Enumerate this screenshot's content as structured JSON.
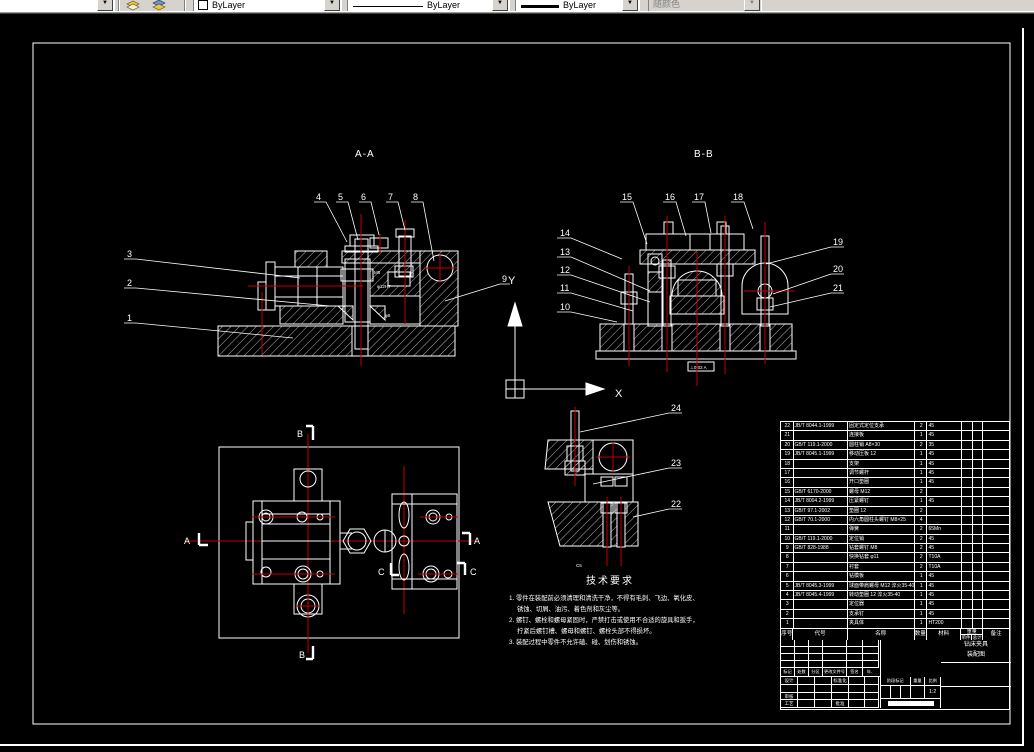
{
  "toolbar": {
    "color_combo": {
      "value": "ByLayer"
    },
    "linetype_combo": {
      "value": "ByLayer"
    },
    "lineweight_combo": {
      "value": "ByLayer"
    },
    "plotstyle_combo": {
      "value": "随颜色"
    },
    "dropdown_arrow": "▼"
  },
  "drawing": {
    "section_labels": {
      "aa": "A-A",
      "bb": "B-B"
    },
    "plan_marks": {
      "top": "B",
      "bottom": "B",
      "left": "A",
      "right": "A",
      "c_inner": "C",
      "c_outer": "C"
    },
    "ucs": {
      "x": "X",
      "y": "Y"
    },
    "balloons": [
      "1",
      "2",
      "3",
      "4",
      "5",
      "6",
      "7",
      "8",
      "9",
      "10",
      "11",
      "12",
      "13",
      "14",
      "15",
      "16",
      "17",
      "18",
      "19",
      "20",
      "21",
      "22",
      "23",
      "24"
    ],
    "dims": {
      "d1": "M8",
      "d2": "φ12H7",
      "d3": "φ8",
      "d4": "C5",
      "tol": "⊥0.02 A"
    }
  },
  "tech_requirements": {
    "title": "技术要求",
    "lines": [
      "1. 零件在装配前必须清理和清洗干净，不得有毛刺、飞边、氧化皮、",
      "锈蚀、切屑、油污、着色剂和灰尘等。",
      "2. 螺钉、螺栓和螺母紧固时，严禁打击或使用不合适的旋具和扳手，",
      "拧紧后螺钉槽、螺母和螺钉、螺栓头部不得损坏。",
      "3. 装配过程中零件不允许磕、碰、划伤和锈蚀。"
    ]
  },
  "bom": {
    "headers": {
      "no": "序号",
      "code": "代号",
      "name": "名称",
      "qty": "数量",
      "mat": "材料",
      "weight": "重量",
      "w1": "单件",
      "w2": "总计",
      "note": "备注"
    },
    "rows": [
      {
        "no": "22",
        "code": "JB/T 8044.1-1999",
        "name": "固定式定位支承",
        "qty": "2",
        "mat": "45",
        "w1": "",
        "w2": "",
        "note": ""
      },
      {
        "no": "21",
        "code": "",
        "name": "连接板",
        "qty": "1",
        "mat": "45",
        "w1": "",
        "w2": "",
        "note": ""
      },
      {
        "no": "20",
        "code": "GB/T 119.1-2000",
        "name": "圆柱销 A8×30",
        "qty": "2",
        "mat": "35",
        "w1": "",
        "w2": "",
        "note": ""
      },
      {
        "no": "19",
        "code": "JB/T 8045.1-1999",
        "name": "移动压板 12",
        "qty": "1",
        "mat": "45",
        "w1": "",
        "w2": "",
        "note": ""
      },
      {
        "no": "18",
        "code": "",
        "name": "支架",
        "qty": "1",
        "mat": "45",
        "w1": "",
        "w2": "",
        "note": ""
      },
      {
        "no": "17",
        "code": "",
        "name": "调节螺杆",
        "qty": "1",
        "mat": "45",
        "w1": "",
        "w2": "",
        "note": ""
      },
      {
        "no": "16",
        "code": "",
        "name": "开口垫圈",
        "qty": "1",
        "mat": "45",
        "w1": "",
        "w2": "",
        "note": ""
      },
      {
        "no": "15",
        "code": "GB/T 6170-2000",
        "name": "螺母 M12",
        "qty": "2",
        "mat": "",
        "w1": "",
        "w2": "",
        "note": ""
      },
      {
        "no": "14",
        "code": "JB/T 8004.2-1999",
        "name": "压紧螺钉",
        "qty": "1",
        "mat": "45",
        "w1": "",
        "w2": "",
        "note": ""
      },
      {
        "no": "13",
        "code": "GB/T 97.1-2002",
        "name": "垫圈 12",
        "qty": "2",
        "mat": "",
        "w1": "",
        "w2": "",
        "note": ""
      },
      {
        "no": "12",
        "code": "GB/T 70.1-2000",
        "name": "内六角圆柱头螺钉 M8×25",
        "qty": "4",
        "mat": "",
        "w1": "",
        "w2": "",
        "note": ""
      },
      {
        "no": "11",
        "code": "",
        "name": "弹簧",
        "qty": "2",
        "mat": "65Mn",
        "w1": "",
        "w2": "",
        "note": ""
      },
      {
        "no": "10",
        "code": "GB/T 119.1-2000",
        "name": "定位销",
        "qty": "2",
        "mat": "45",
        "w1": "",
        "w2": "",
        "note": ""
      },
      {
        "no": "9",
        "code": "GB/T 828-1988",
        "name": "钻套螺钉 M8",
        "qty": "2",
        "mat": "45",
        "w1": "",
        "w2": "",
        "note": ""
      },
      {
        "no": "8",
        "code": "",
        "name": "快换钻套 φ11",
        "qty": "2",
        "mat": "T10A",
        "w1": "",
        "w2": "",
        "note": ""
      },
      {
        "no": "7",
        "code": "",
        "name": "衬套",
        "qty": "2",
        "mat": "T10A",
        "w1": "",
        "w2": "",
        "note": ""
      },
      {
        "no": "6",
        "code": "",
        "name": "钻模板",
        "qty": "1",
        "mat": "45",
        "w1": "",
        "w2": "",
        "note": ""
      },
      {
        "no": "5",
        "code": "JB/T 8045.3-1999",
        "name": "球面带肩螺母 M12 淬火35-40",
        "qty": "1",
        "mat": "45",
        "w1": "",
        "w2": "",
        "note": ""
      },
      {
        "no": "4",
        "code": "JB/T 8045.4-1999",
        "name": "转动垫圈 12 淬火35-40",
        "qty": "1",
        "mat": "45",
        "w1": "",
        "w2": "",
        "note": ""
      },
      {
        "no": "3",
        "code": "",
        "name": "定位器",
        "qty": "1",
        "mat": "45",
        "w1": "",
        "w2": "",
        "note": ""
      },
      {
        "no": "2",
        "code": "",
        "name": "支承钉",
        "qty": "1",
        "mat": "45",
        "w1": "",
        "w2": "",
        "note": ""
      },
      {
        "no": "1",
        "code": "",
        "name": "夹具体",
        "qty": "1",
        "mat": "HT200",
        "w1": "",
        "w2": "",
        "note": ""
      }
    ]
  },
  "title_block": {
    "rev_headers": [
      "标记",
      "处数",
      "分区",
      "更改文件号",
      "签名",
      "年、月、日"
    ],
    "sig_labels": {
      "design": "设计",
      "standard": "标准化",
      "check": "审核",
      "process": "工艺",
      "approve": "批准"
    },
    "stage_headers": [
      "阶段标记",
      "重量",
      "比例"
    ],
    "scale_value": "1:2",
    "name_line1": "钻床夹具",
    "name_line2": "装配图"
  }
}
